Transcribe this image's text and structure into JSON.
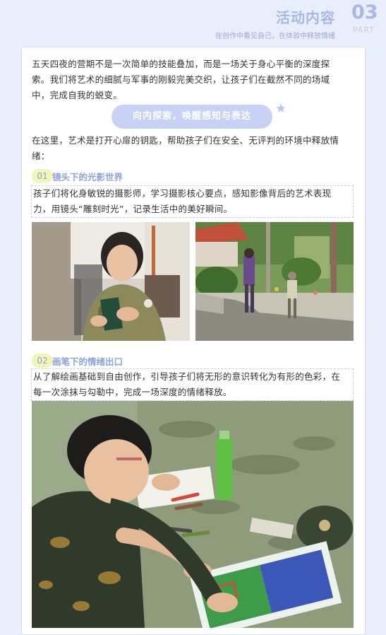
{
  "header": {
    "title": "活动内容",
    "subtitle": "在创作中看见自己，在体验中释放情绪",
    "number": "03",
    "part_label": "PART"
  },
  "intro": {
    "line1": "五天四夜的营期不是一次简单的技能叠加，而是一场关于身心平衡的深度探",
    "line2": "索。我们将艺术的细腻与军事的刚毅完美交织，让孩子们在截然不同的场域",
    "line3": "中，完成自我的蜕变。"
  },
  "banner": {
    "label": "向内探索，唤醒感知与表达"
  },
  "paragraph2": {
    "line1": "在这里，艺术是打开心扉的钥匙，帮助孩子们在安全、无评判的环境中释放情",
    "line2": "绪："
  },
  "sections": [
    {
      "number": "01",
      "title": "镜头下的光影世界",
      "line1": "孩子们将化身敏锐的摄影师，学习摄影核心要点，感知影像背后的艺术表现",
      "line2": "力，用镜头“雕刻时光”，记录生活中的美好瞬间。"
    },
    {
      "number": "02",
      "title": "画笔下的情绪出口",
      "line1": "从了解绘画基础到自由创作，引导孩子们将无形的意识转化为有形的色彩，在",
      "line2": "每一次涂抹与勾勒中，完成一场深度的情绪释放。"
    }
  ],
  "colors": {
    "background": "#e9eefb",
    "accent": "#a9b8e2",
    "pill": "#c7d2f5",
    "section_badge": "#f1f6b8"
  }
}
